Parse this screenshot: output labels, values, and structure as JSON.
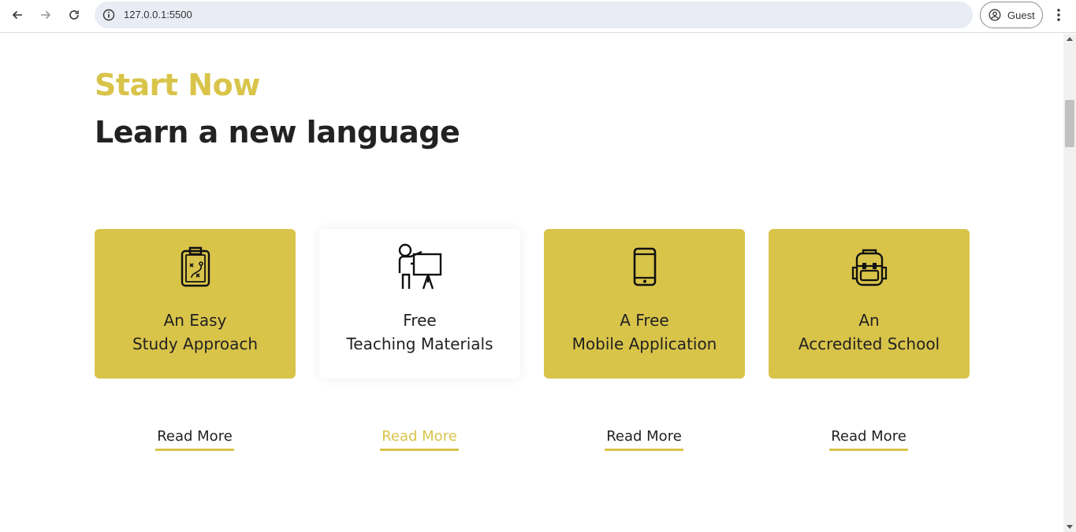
{
  "browser": {
    "url": "127.0.0.1:5500",
    "profile_label": "Guest"
  },
  "page": {
    "eyebrow": "Start Now",
    "headline": "Learn a new language",
    "accent_color": "#d9c44a",
    "cards": [
      {
        "icon": "clipboard-strategy-icon",
        "line1": "An Easy",
        "line2": "Study Approach",
        "link": "Read More"
      },
      {
        "icon": "teacher-board-icon",
        "line1": "Free",
        "line2": "Teaching Materials",
        "link": "Read More"
      },
      {
        "icon": "mobile-phone-icon",
        "line1": "A Free",
        "line2": "Mobile Application",
        "link": "Read More"
      },
      {
        "icon": "backpack-icon",
        "line1": "An",
        "line2": "Accredited School",
        "link": "Read More"
      }
    ]
  }
}
